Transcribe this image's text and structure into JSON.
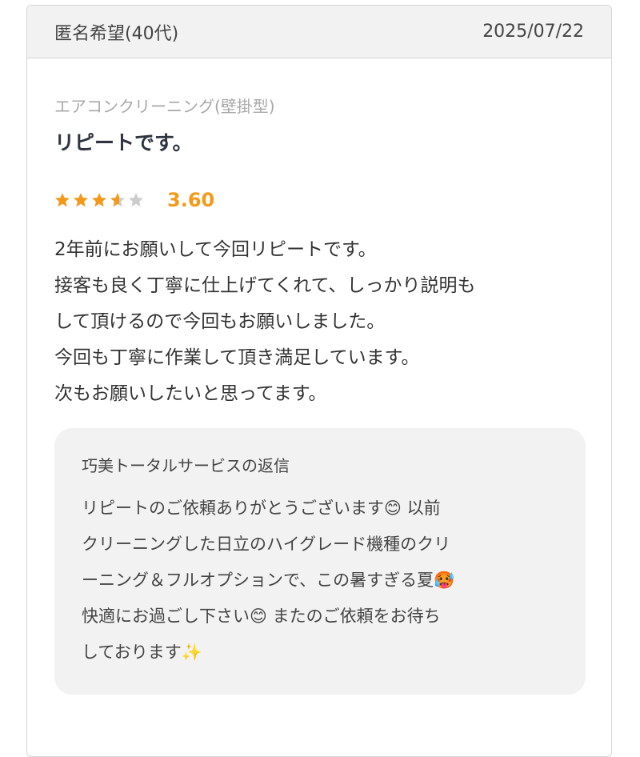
{
  "review": {
    "reviewer": "匿名希望(40代)",
    "date": "2025/07/22",
    "service": "エアコンクリーニング(壁掛型)",
    "title": "リピートです。",
    "rating": {
      "value": 3.6,
      "value_label": "3.60",
      "max": 5,
      "star_color": "#f39a1b",
      "empty_star_color": "#cccccc"
    },
    "body_lines": [
      "2年前にお願いして今回リピートです。",
      "接客も良く丁寧に仕上げてくれて、しっかり説明も",
      "して頂けるので今回もお願いしました。",
      "今回も丁寧に作業して頂き満足しています。",
      "次もお願いしたいと思ってます。"
    ]
  },
  "reply": {
    "title": "巧美トータルサービスの返信",
    "lines": [
      "リピートのご依頼ありがとうございます😊 以前",
      "クリーニングした日立のハイグレード機種のクリ",
      "ーニング＆フルオプションで、この暑すぎる夏🥵",
      "快適にお過ごし下さい😊 またのご依頼をお待ち",
      "しております✨"
    ]
  }
}
